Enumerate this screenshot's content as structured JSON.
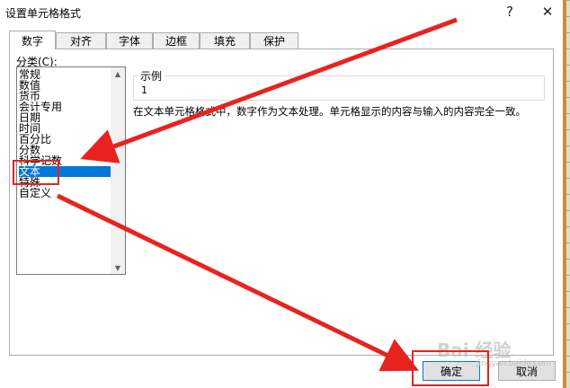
{
  "window": {
    "title": "设置单元格格式",
    "help_glyph": "?",
    "close_glyph": "✕"
  },
  "tabs": [
    {
      "label": "数字",
      "active": true
    },
    {
      "label": "对齐"
    },
    {
      "label": "字体"
    },
    {
      "label": "边框"
    },
    {
      "label": "填充"
    },
    {
      "label": "保护"
    }
  ],
  "category": {
    "label": "分类(C):",
    "items": [
      "常规",
      "数值",
      "货币",
      "会计专用",
      "日期",
      "时间",
      "百分比",
      "分数",
      "科学记数",
      "文本",
      "特殊",
      "自定义"
    ],
    "selected": "文本"
  },
  "sample": {
    "label": "示例",
    "value": "1"
  },
  "description": "在文本单元格格式中，数字作为文本处理。单元格显示的内容与输入的内容完全一致。",
  "buttons": {
    "ok": "确定",
    "cancel": "取消"
  },
  "watermark": {
    "text": "Bai 经验",
    "sub": "jingyan.baidu.com"
  },
  "colors": {
    "accent": "#0078d7",
    "annotation": "#e8231f"
  }
}
